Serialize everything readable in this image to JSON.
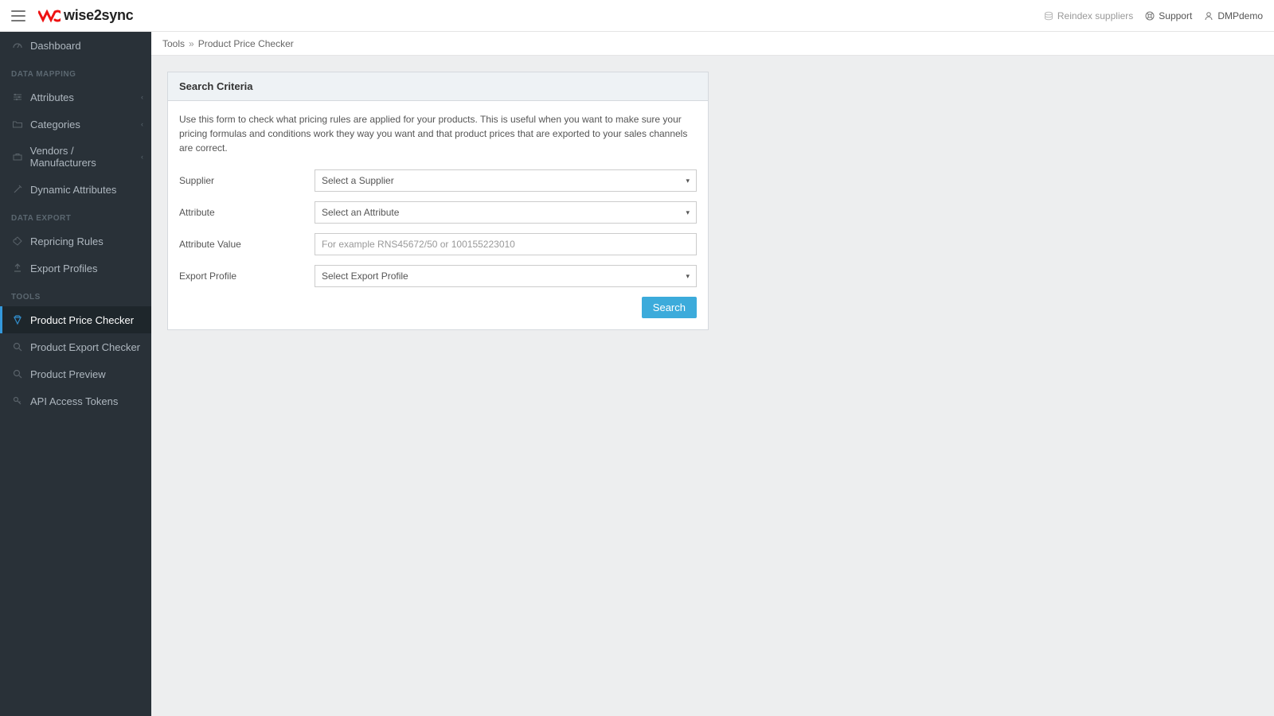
{
  "header": {
    "brand_prefix": "W",
    "brand_text": "wise2sync",
    "links": {
      "reindex": "Reindex suppliers",
      "support": "Support",
      "user": "DMPdemo"
    }
  },
  "sidebar": {
    "dashboard": "Dashboard",
    "section_mapping": "DATA MAPPING",
    "attributes": "Attributes",
    "categories": "Categories",
    "vendors": "Vendors / Manufacturers",
    "dynamic_attrs": "Dynamic Attributes",
    "section_export": "DATA EXPORT",
    "repricing": "Repricing Rules",
    "export_profiles": "Export Profiles",
    "section_tools": "TOOLS",
    "price_checker": "Product Price Checker",
    "export_checker": "Product Export Checker",
    "preview": "Product Preview",
    "api_tokens": "API Access Tokens"
  },
  "breadcrumb": {
    "parent": "Tools",
    "sep": "»",
    "current": "Product Price Checker"
  },
  "panel": {
    "title": "Search Criteria",
    "description": "Use this form to check what pricing rules are applied for your products. This is useful when you want to make sure your pricing formulas and conditions work they way you want and that product prices that are exported to your sales channels are correct."
  },
  "form": {
    "supplier_label": "Supplier",
    "supplier_placeholder": "Select a Supplier",
    "attribute_label": "Attribute",
    "attribute_placeholder": "Select an Attribute",
    "attrvalue_label": "Attribute Value",
    "attrvalue_placeholder": "For example RNS45672/50 or 100155223010",
    "exportprofile_label": "Export Profile",
    "exportprofile_placeholder": "Select Export Profile",
    "search_btn": "Search"
  }
}
